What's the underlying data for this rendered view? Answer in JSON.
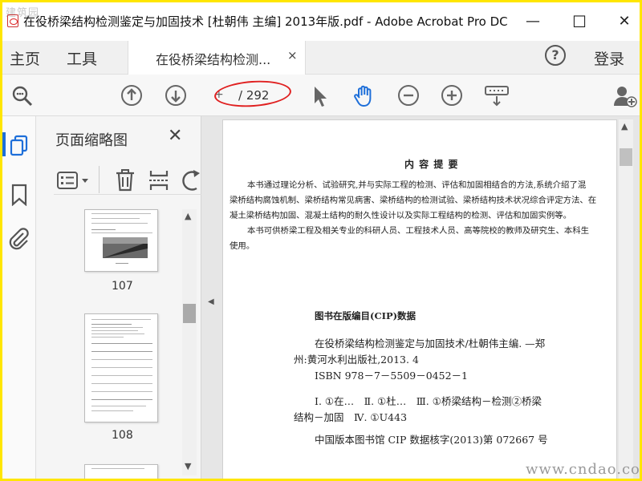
{
  "window": {
    "title": "在役桥梁结构检测鉴定与加固技术 [杜朝伟 主编] 2013年版.pdf - Adobe Acrobat Pro DC",
    "watermark_top": "建筑园",
    "minimize": "—",
    "maximize": "☐",
    "close": "✕"
  },
  "tabs": {
    "home": "主页",
    "tools": "工具",
    "document": "在役桥梁结构检测...",
    "document_close": "×",
    "help": "?",
    "login": "登录"
  },
  "toolbar": {
    "page_current": "+",
    "page_total": "/ 292"
  },
  "panel": {
    "title": "页面缩略图",
    "close": "✕",
    "thumbnails": [
      {
        "label": "107"
      },
      {
        "label": "108"
      }
    ]
  },
  "page_content": {
    "heading": "内 容 提 要",
    "para1_lines": [
      "本书通过理论分析、试验研究,并与实际工程的检测、评估和加固相结合的方法,系统介绍了混",
      "梁桥结构腐蚀机制、梁桥结构常见病害、梁桥结构的检测试验、梁桥结构技术状况综合评定方法、在",
      "凝土梁桥结构加固、混凝土结构的耐久性设计以及实际工程结构的检测、评估和加固实例等。"
    ],
    "para2_lines": [
      "本书可供桥梁工程及相关专业的科研人员、工程技术人员、高等院校的教师及研究生、本科生",
      "使用。"
    ],
    "cip_heading": "图书在版编目(CIP)数据",
    "cip_line1": "在役桥梁结构检测鉴定与加固技术/杜朝伟主编. —郑",
    "cip_line2": "州:黄河水利出版社,2013. 4",
    "cip_isbn": "ISBN 978－7－5509－0452－1",
    "cip_class1": "Ⅰ. ①在…　Ⅱ. ①杜…　Ⅲ. ①桥梁结构－检测②桥梁",
    "cip_class2": "结构－加固　Ⅳ. ①U443",
    "cip_record": "中国版本图书馆 CIP 数据核字(2013)第 072667 号"
  },
  "watermark_bottom": "www.cndao.com",
  "colors": {
    "accent_blue": "#1e6fd9",
    "annotation_red": "#e02020",
    "frame_yellow": "#ffe600"
  }
}
